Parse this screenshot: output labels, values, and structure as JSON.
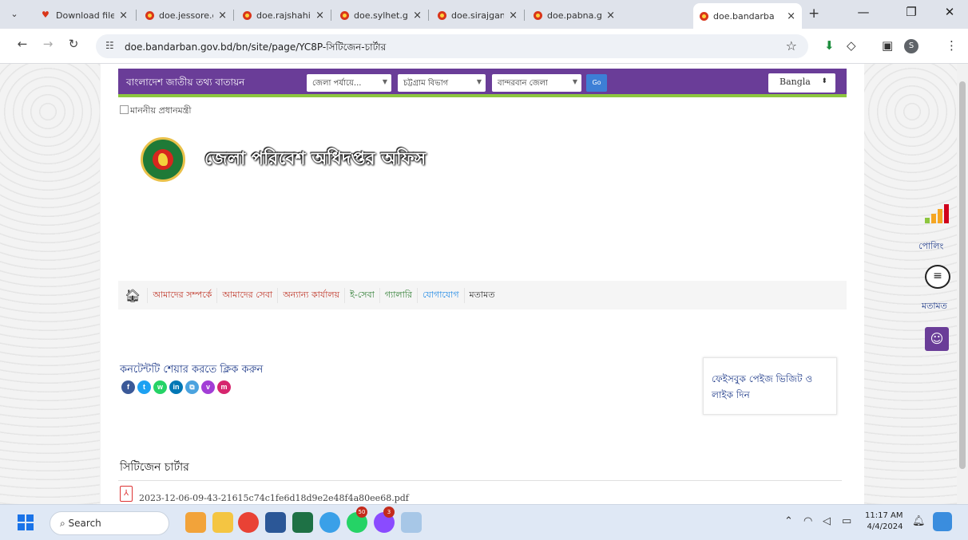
{
  "browser": {
    "tabs": [
      {
        "label": "Download file",
        "icon": "heart-icon"
      },
      {
        "label": "doe.jessore.g",
        "icon": "site-icon"
      },
      {
        "label": "doe.rajshahi.g",
        "icon": "site-icon"
      },
      {
        "label": "doe.sylhet.gov",
        "icon": "site-icon"
      },
      {
        "label": "doe.sirajganj.",
        "icon": "site-icon"
      },
      {
        "label": "doe.pabna.go",
        "icon": "site-icon"
      },
      {
        "label": "doe.bandarba",
        "icon": "site-icon",
        "active": true
      }
    ],
    "url": "doe.bandarban.gov.bd/bn/site/page/YC8P-সিটিজেন-চার্টার"
  },
  "portal": {
    "title": "বাংলাদেশ জাতীয় তথ্য বাতায়ন",
    "selects": [
      "জেলা পর্যায়ে...",
      "চট্টগ্রাম বিভাগ",
      "বান্দরবান জেলা"
    ],
    "go_label": "Go",
    "language": "Bangla"
  },
  "banner": {
    "alt_text": "মাননীয় প্রধানমন্ত্রী",
    "site_title": "জেলা পরিবেশ অধিদপ্তর অফিস"
  },
  "nav": {
    "items": [
      {
        "label": "আমাদের সম্পর্কে",
        "color": "#c0392b"
      },
      {
        "label": "আমাদের সেবা",
        "color": "#c0392b"
      },
      {
        "label": "অন্যান্য কার্যালয়",
        "color": "#c0392b"
      },
      {
        "label": "ই-সেবা",
        "color": "#2e7d32"
      },
      {
        "label": "গ্যালারি",
        "color": "#2e7d32"
      },
      {
        "label": "যোগাযোগ",
        "color": "#1e88e5"
      },
      {
        "label": "মতামত",
        "color": "#333333"
      }
    ]
  },
  "share": {
    "label": "কনটেন্টটি শেয়ার করতে ক্লিক করুন",
    "icons": [
      {
        "name": "facebook-icon",
        "glyph": "f",
        "color": "#3b5998"
      },
      {
        "name": "twitter-icon",
        "glyph": "t",
        "color": "#1da1f2"
      },
      {
        "name": "whatsapp-icon",
        "glyph": "w",
        "color": "#25d366"
      },
      {
        "name": "linkedin-icon",
        "glyph": "in",
        "color": "#0077b5"
      },
      {
        "name": "copy-link-icon",
        "glyph": "⧉",
        "color": "#4aa3df"
      },
      {
        "name": "viber-icon",
        "glyph": "v",
        "color": "#a23ed6"
      },
      {
        "name": "messenger-icon",
        "glyph": "m",
        "color": "#d6256e"
      }
    ]
  },
  "facebook_box": {
    "text": "ফেইসবুক পেইজ ভিজিট ও লাইক দিন"
  },
  "content": {
    "title": "সিটিজেন চার্টার",
    "file_name": "2023-12-06-09-43-21615c74c1fe6d18d9e2e48f4a80ee68.pdf"
  },
  "widgets": {
    "poll_label": "পোলিং",
    "feedback_label": "মতামত"
  },
  "taskbar": {
    "search_placeholder": "Search",
    "time": "11:17 AM",
    "date": "4/4/2024",
    "badges": [
      "50",
      "3"
    ]
  }
}
